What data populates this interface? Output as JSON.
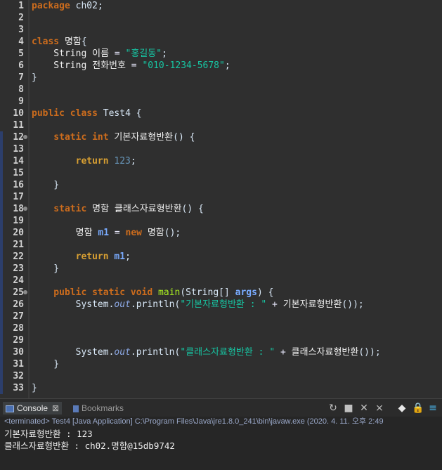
{
  "editor": {
    "lines": [
      {
        "n": "1",
        "tokens": [
          {
            "t": "package",
            "c": "kw"
          },
          {
            "t": " ch02;",
            "c": "plain"
          }
        ]
      },
      {
        "n": "2",
        "tokens": []
      },
      {
        "n": "3",
        "tokens": []
      },
      {
        "n": "4",
        "tokens": [
          {
            "t": "class",
            "c": "kw"
          },
          {
            "t": " ",
            "c": "plain"
          },
          {
            "t": "명함",
            "c": "kor"
          },
          {
            "t": "{",
            "c": "plain"
          }
        ]
      },
      {
        "n": "5",
        "tokens": [
          {
            "t": "    String",
            "c": "ty"
          },
          {
            "t": " ",
            "c": "plain"
          },
          {
            "t": "이름",
            "c": "kor"
          },
          {
            "t": " = ",
            "c": "op"
          },
          {
            "t": "\"홍길동\"",
            "c": "str"
          },
          {
            "t": ";",
            "c": "plain"
          }
        ]
      },
      {
        "n": "6",
        "tokens": [
          {
            "t": "    String",
            "c": "ty"
          },
          {
            "t": " ",
            "c": "plain"
          },
          {
            "t": "전화번호",
            "c": "kor"
          },
          {
            "t": " = ",
            "c": "op"
          },
          {
            "t": "\"010-1234-5678\"",
            "c": "str"
          },
          {
            "t": ";",
            "c": "plain"
          }
        ]
      },
      {
        "n": "7",
        "tokens": [
          {
            "t": "}",
            "c": "plain"
          }
        ]
      },
      {
        "n": "8",
        "tokens": []
      },
      {
        "n": "9",
        "tokens": []
      },
      {
        "n": "10",
        "tokens": [
          {
            "t": "public",
            "c": "kw"
          },
          {
            "t": " ",
            "c": "plain"
          },
          {
            "t": "class",
            "c": "kw"
          },
          {
            "t": " Test4 {",
            "c": "plain"
          }
        ]
      },
      {
        "n": "11",
        "tokens": []
      },
      {
        "n": "12",
        "fold": true,
        "tokens": [
          {
            "t": "    static",
            "c": "kw"
          },
          {
            "t": " ",
            "c": "plain"
          },
          {
            "t": "int",
            "c": "kw"
          },
          {
            "t": " ",
            "c": "plain"
          },
          {
            "t": "기본자료형반환",
            "c": "kor"
          },
          {
            "t": "() {",
            "c": "plain"
          }
        ]
      },
      {
        "n": "13",
        "tokens": []
      },
      {
        "n": "14",
        "tokens": [
          {
            "t": "        return",
            "c": "ret"
          },
          {
            "t": " ",
            "c": "plain"
          },
          {
            "t": "123",
            "c": "num"
          },
          {
            "t": ";",
            "c": "plain"
          }
        ]
      },
      {
        "n": "15",
        "tokens": []
      },
      {
        "n": "16",
        "tokens": [
          {
            "t": "    }",
            "c": "plain"
          }
        ]
      },
      {
        "n": "17",
        "tokens": []
      },
      {
        "n": "18",
        "fold": true,
        "tokens": [
          {
            "t": "    static",
            "c": "kw"
          },
          {
            "t": " ",
            "c": "plain"
          },
          {
            "t": "명함",
            "c": "kor"
          },
          {
            "t": " ",
            "c": "plain"
          },
          {
            "t": "클래스자료형반환",
            "c": "kor"
          },
          {
            "t": "() {",
            "c": "plain"
          }
        ]
      },
      {
        "n": "19",
        "tokens": []
      },
      {
        "n": "20",
        "tokens": [
          {
            "t": "        ",
            "c": "plain"
          },
          {
            "t": "명함",
            "c": "kor"
          },
          {
            "t": " ",
            "c": "plain"
          },
          {
            "t": "m1",
            "c": "var"
          },
          {
            "t": " = ",
            "c": "op"
          },
          {
            "t": "new",
            "c": "kw"
          },
          {
            "t": " ",
            "c": "plain"
          },
          {
            "t": "명함",
            "c": "kor"
          },
          {
            "t": "();",
            "c": "plain"
          }
        ]
      },
      {
        "n": "21",
        "tokens": []
      },
      {
        "n": "22",
        "tokens": [
          {
            "t": "        return",
            "c": "ret"
          },
          {
            "t": " ",
            "c": "plain"
          },
          {
            "t": "m1",
            "c": "var"
          },
          {
            "t": ";",
            "c": "plain"
          }
        ]
      },
      {
        "n": "23",
        "tokens": [
          {
            "t": "    }",
            "c": "plain"
          }
        ]
      },
      {
        "n": "24",
        "tokens": []
      },
      {
        "n": "25",
        "fold": true,
        "tokens": [
          {
            "t": "    public",
            "c": "kw"
          },
          {
            "t": " ",
            "c": "plain"
          },
          {
            "t": "static",
            "c": "kw"
          },
          {
            "t": " ",
            "c": "plain"
          },
          {
            "t": "void",
            "c": "kw"
          },
          {
            "t": " ",
            "c": "plain"
          },
          {
            "t": "main",
            "c": "meth"
          },
          {
            "t": "(String[] ",
            "c": "plain"
          },
          {
            "t": "args",
            "c": "var"
          },
          {
            "t": ") {",
            "c": "plain"
          }
        ]
      },
      {
        "n": "26",
        "tokens": [
          {
            "t": "        System.",
            "c": "plain"
          },
          {
            "t": "out",
            "c": "sfield"
          },
          {
            "t": ".println(",
            "c": "plain"
          },
          {
            "t": "\"기본자료형반환 : \"",
            "c": "str"
          },
          {
            "t": " + ",
            "c": "op"
          },
          {
            "t": "기본자료형반환",
            "c": "kor"
          },
          {
            "t": "());",
            "c": "plain"
          }
        ]
      },
      {
        "n": "27",
        "tokens": []
      },
      {
        "n": "28",
        "tokens": []
      },
      {
        "n": "29",
        "tokens": []
      },
      {
        "n": "30",
        "tokens": [
          {
            "t": "        System.",
            "c": "plain"
          },
          {
            "t": "out",
            "c": "sfield"
          },
          {
            "t": ".println(",
            "c": "plain"
          },
          {
            "t": "\"클래스자료형반환 : \"",
            "c": "str"
          },
          {
            "t": " + ",
            "c": "op"
          },
          {
            "t": "클래스자료형반환",
            "c": "kor"
          },
          {
            "t": "());",
            "c": "plain"
          }
        ]
      },
      {
        "n": "31",
        "tokens": [
          {
            "t": "    }",
            "c": "plain"
          }
        ]
      },
      {
        "n": "32",
        "tokens": []
      },
      {
        "n": "33",
        "tokens": [
          {
            "t": "}",
            "c": "plain"
          }
        ]
      }
    ]
  },
  "console": {
    "tab_console": "Console",
    "tab_bookmarks": "Bookmarks",
    "terminated": "<terminated> Test4 [Java Application] C:\\Program Files\\Java\\jre1.8.0_241\\bin\\javaw.exe (2020. 4. 11. 오후 2:49",
    "output": [
      "기본자료형반환 : 123",
      "클래스자료형반환 : ch02.명함@15db9742"
    ],
    "tools": [
      {
        "icon": "refresh-icon",
        "glyph": "↻"
      },
      {
        "icon": "stop-icon",
        "glyph": "■"
      },
      {
        "icon": "remove-launch-icon",
        "glyph": "✕"
      },
      {
        "icon": "remove-all-icon",
        "glyph": "⨯"
      },
      {
        "icon": "clear-console-icon",
        "glyph": "◆"
      },
      {
        "icon": "scroll-lock-icon",
        "glyph": "🔒"
      },
      {
        "icon": "word-wrap-icon",
        "glyph": "≡"
      }
    ]
  },
  "colors": {
    "editor_bg": "#2f2f2f",
    "keyword": "#cc6c1d",
    "string": "#17c6a3",
    "number": "#6897bb",
    "method": "#a7ec21"
  }
}
